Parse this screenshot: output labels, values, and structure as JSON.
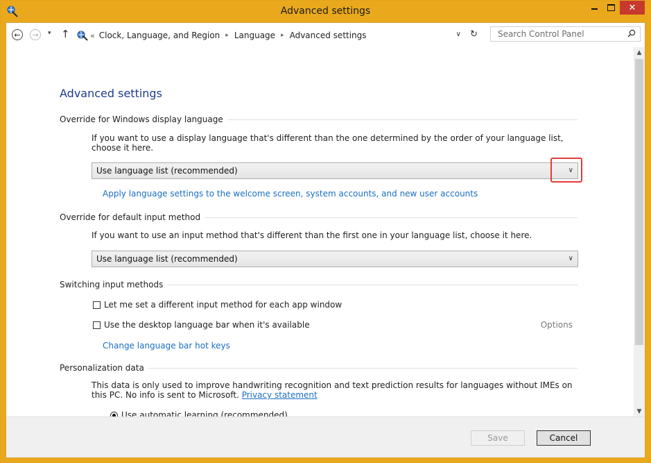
{
  "window": {
    "title": "Advanced settings",
    "close_glyph": "✕"
  },
  "nav": {
    "back_glyph": "←",
    "forward_glyph": "→",
    "recent_glyph": "▾",
    "up_glyph": "↑",
    "breadcrumb_lead": "«",
    "breadcrumbs": [
      "Clock, Language, and Region",
      "Language",
      "Advanced settings"
    ],
    "crumb_sep": "▸",
    "dropdown_glyph": "∨",
    "refresh_glyph": "↻",
    "search_placeholder": "Search Control Panel"
  },
  "content": {
    "page_title": "Advanced settings",
    "display_language": {
      "section_label": "Override for Windows display language",
      "description": "If you want to use a display language that's different than the one determined by the order of your language list, choose it here.",
      "dropdown_value": "Use language list (recommended)",
      "link": "Apply language settings to the welcome screen, system accounts, and new user accounts"
    },
    "input_method": {
      "section_label": "Override for default input method",
      "description": "If you want to use an input method that's different than the first one in your language list, choose it here.",
      "dropdown_value": "Use language list (recommended)"
    },
    "switching": {
      "section_label": "Switching input methods",
      "checkbox1_label": "Let me set a different input method for each app window",
      "checkbox2_label": "Use the desktop language bar when it's available",
      "options_link": "Options",
      "hotkeys_link": "Change language bar hot keys"
    },
    "personalization": {
      "section_label": "Personalization data",
      "description": "This data is only used to improve handwriting recognition and text prediction results for languages without IMEs on this PC. No info is sent to Microsoft.",
      "privacy_link": "Privacy statement",
      "radio1_label": "Use automatic learning (recommended)"
    },
    "dropdown_chevron": "∨"
  },
  "scrollbar": {
    "up_glyph": "▲",
    "down_glyph": "▼"
  },
  "footer": {
    "save_label": "Save",
    "cancel_label": "Cancel"
  },
  "colors": {
    "window_frame": "#eaa91c",
    "close_button": "#c7382d",
    "link": "#1a6fc1",
    "title_blue": "#1e3c8c",
    "highlight_red": "#e63a3a"
  }
}
